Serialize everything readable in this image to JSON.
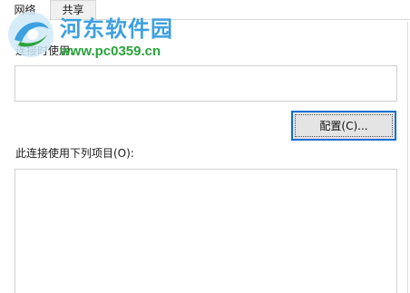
{
  "tabs": {
    "network_label": "网络",
    "sharing_label": "共享"
  },
  "watermark": {
    "site_name": "河东软件园",
    "site_url": "www.pc0359.cn",
    "name_color": "#3da0e0",
    "url_color": "#29a33b"
  },
  "connect_using": {
    "label": "连接时使用:",
    "adapter_value": ""
  },
  "configure_button": {
    "label": "配置(C)..."
  },
  "items": {
    "label": "此连接使用下列项目(O):",
    "entries": []
  },
  "colors": {
    "focus_border": "#0d6fd1",
    "button_face": "#e4e4e4"
  }
}
